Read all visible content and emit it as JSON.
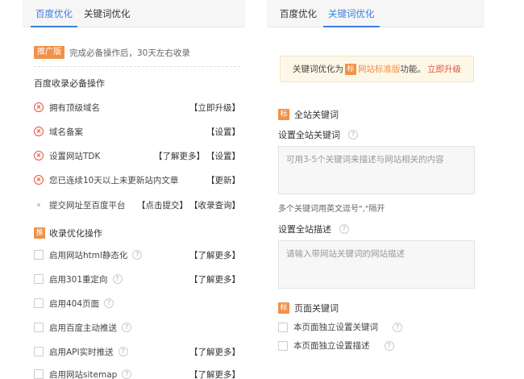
{
  "left": {
    "tabs": [
      {
        "label": "百度优化",
        "active": true
      },
      {
        "label": "关键词优化",
        "active": false
      }
    ],
    "promo": {
      "badge": "推广版",
      "text": "完成必备操作后，30天左右收录"
    },
    "required_title": "百度收录必备操作",
    "required_items": [
      {
        "status": "error",
        "label": "拥有顶级域名",
        "actions": [
          "【立即升级】"
        ]
      },
      {
        "status": "error",
        "label": "域名备案",
        "actions": [
          "【设置】"
        ]
      },
      {
        "status": "error",
        "label": "设置网站TDK",
        "actions": [
          "【了解更多】",
          "【设置】"
        ]
      },
      {
        "status": "error",
        "label": "您已连续10天以上未更新站内文章",
        "actions": [
          "【更新】"
        ]
      },
      {
        "status": "pending",
        "label": "提交网址至百度平台",
        "actions": [
          "【点击提交】",
          "【收录查询】"
        ]
      }
    ],
    "optimize_badge": "推",
    "optimize_title": "收录优化操作",
    "optimize_items": [
      {
        "label": "启用网站html静态化",
        "help": "?",
        "action": "【了解更多】"
      },
      {
        "label": "启用301重定向",
        "help": "?",
        "action": "【了解更多】"
      },
      {
        "label": "启用404页面",
        "help": "?",
        "action": ""
      },
      {
        "label": "启用百度主动推送",
        "help": "?",
        "action": ""
      },
      {
        "label": "启用API实时推送",
        "help": "?",
        "action": "【了解更多】"
      },
      {
        "label": "启用网站sitemap",
        "help": "?",
        "action": "【了解更多】"
      }
    ]
  },
  "right": {
    "tabs": [
      {
        "label": "百度优化",
        "active": false
      },
      {
        "label": "关键词优化",
        "active": true
      }
    ],
    "notice": {
      "prefix": "关键词优化为",
      "badge": "标",
      "standard": "网站标准版",
      "suffix": "功能。",
      "upgrade": "立即升级"
    },
    "site_keywords": {
      "badge": "标",
      "title": "全站关键词",
      "label": "设置全站关键词",
      "help": "?",
      "placeholder": "可用3-5个关键词来描述与网站相关的内容",
      "hint": "多个关键词用英文逗号\",\"隔开"
    },
    "site_desc": {
      "label": "设置全站描述",
      "help": "?",
      "placeholder": "请输入带网站关键词的网站描述"
    },
    "page_keywords": {
      "badge": "标",
      "title": "页面关键词",
      "items": [
        {
          "label": "本页面独立设置关键词",
          "help": "?"
        },
        {
          "label": "本页面独立设置描述",
          "help": "?"
        }
      ]
    }
  },
  "colors": {
    "accent": "#3b7fdc",
    "orange": "#f19149",
    "error": "#e4553c",
    "notice_bg": "#fdf7e7"
  }
}
